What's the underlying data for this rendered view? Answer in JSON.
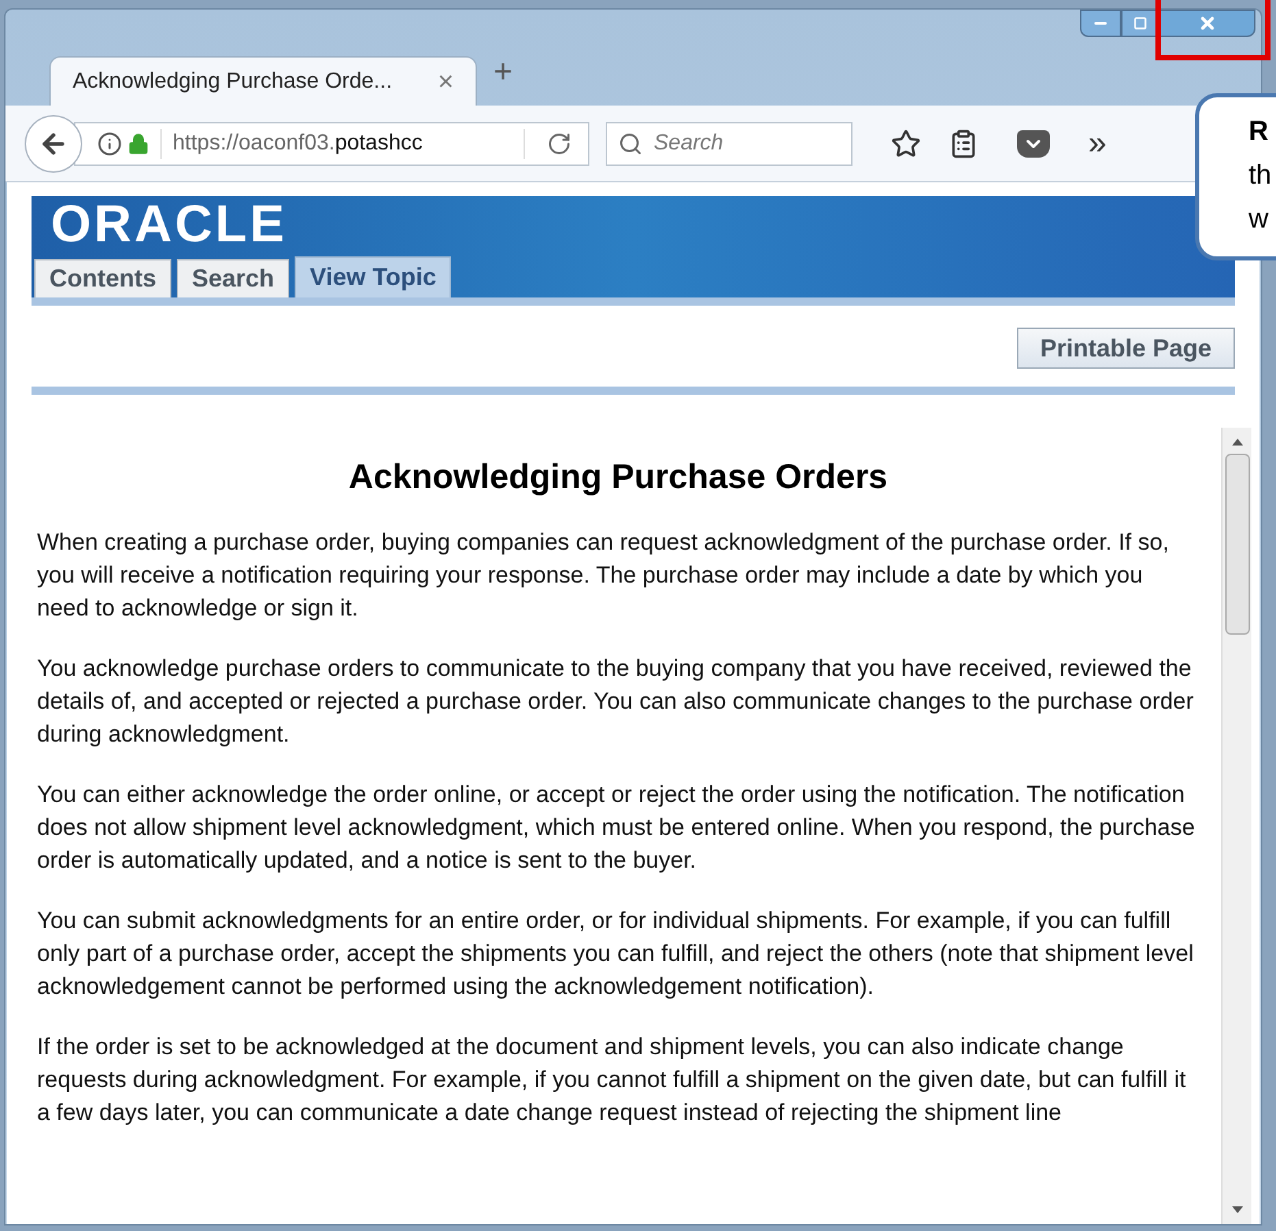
{
  "browser": {
    "tab_title": "Acknowledging Purchase Orde...",
    "tab_close": "×",
    "new_tab": "+",
    "url_prefix": "https://oaconf03.",
    "url_domain": "potashcc",
    "search_placeholder": "Search",
    "overflow": "»"
  },
  "site": {
    "logo": "ORACLE",
    "tabs": [
      {
        "label": "Contents",
        "selected": false
      },
      {
        "label": "Search",
        "selected": false
      },
      {
        "label": "View Topic",
        "selected": true
      }
    ],
    "printable_button": "Printable Page"
  },
  "article": {
    "title": "Acknowledging Purchase Orders",
    "paragraphs": [
      "When creating a purchase order, buying companies can request acknowledgment of the purchase order. If so, you will receive a notification requiring your response. The purchase order may include a date by which you need to acknowledge or sign it.",
      "You acknowledge purchase orders to communicate to the buying company that you have received, reviewed the details of, and accepted or rejected a purchase order. You can also communicate changes to the purchase order during acknowledgment.",
      "You can either acknowledge the order online, or accept or reject the order using the notification. The notification does not allow shipment level acknowledgment, which must be entered online. When you respond, the purchase order is automatically updated, and a notice is sent to the buyer.",
      "You can submit acknowledgments for an entire order, or for individual shipments. For example, if you can fulfill only part of a purchase order, accept the shipments you can fulfill, and reject the others (note that shipment level acknowledgement cannot be performed using the acknowledgement notification).",
      "If the order is set to be acknowledged at the document and shipment levels, you can also indicate change requests during acknowledgment. For example, if you cannot fulfill a shipment on the given date, but can fulfill it a few days later, you can communicate a date change request instead of rejecting the shipment line"
    ]
  },
  "callout": {
    "lines": [
      "R",
      "th",
      "w"
    ]
  }
}
